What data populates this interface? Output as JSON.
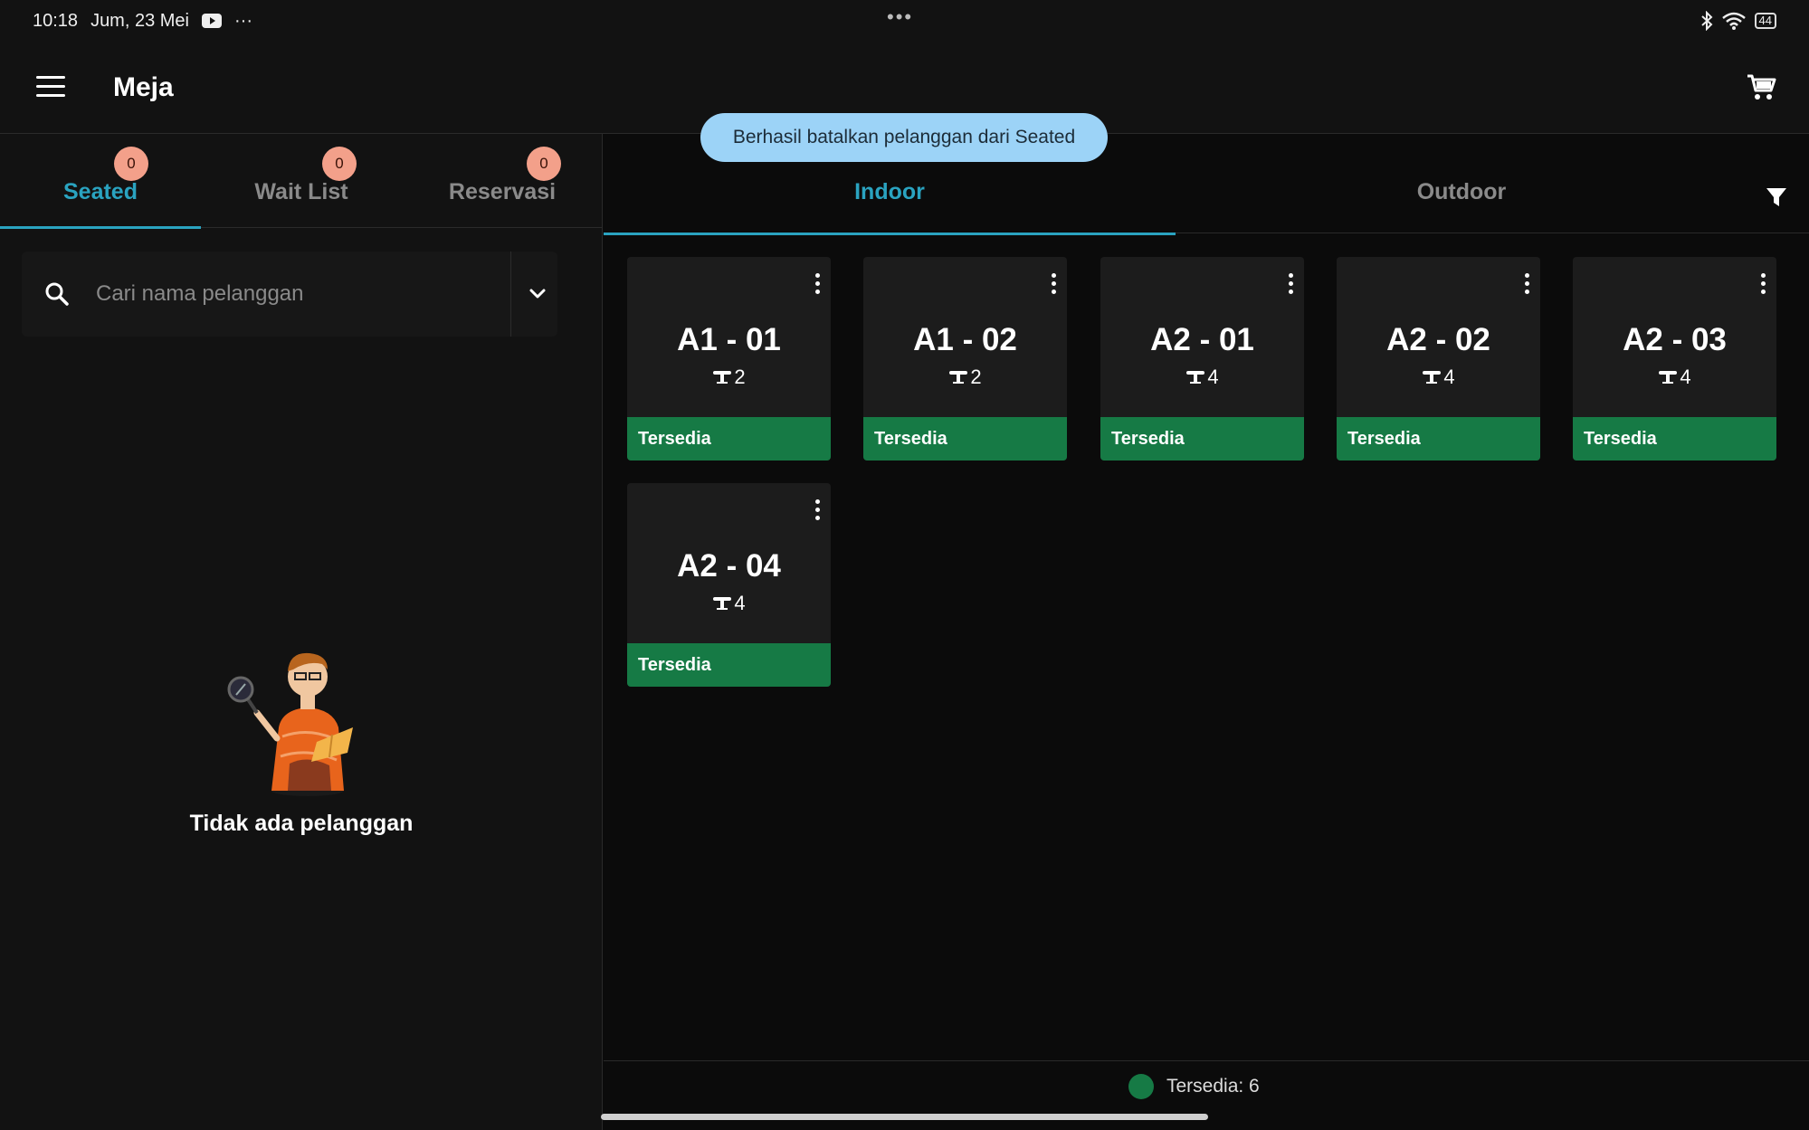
{
  "status_bar": {
    "time": "10:18",
    "date": "Jum, 23 Mei",
    "more_dots": "···",
    "center_dots": "•••",
    "battery": "44"
  },
  "app_bar": {
    "title": "Meja"
  },
  "left_tabs": [
    {
      "label": "Seated",
      "badge": "0",
      "active": true
    },
    {
      "label": "Wait List",
      "badge": "0",
      "active": false
    },
    {
      "label": "Reservasi",
      "badge": "0",
      "active": false
    }
  ],
  "search": {
    "placeholder": "Cari nama pelanggan",
    "value": ""
  },
  "empty_state": {
    "text": "Tidak ada pelanggan"
  },
  "right_tabs": [
    {
      "label": "Indoor",
      "active": true
    },
    {
      "label": "Outdoor",
      "active": false
    }
  ],
  "toast": {
    "text": "Berhasil batalkan pelanggan dari Seated"
  },
  "tables": [
    {
      "name": "A1 - 01",
      "capacity": "2",
      "status": "Tersedia"
    },
    {
      "name": "A1 - 02",
      "capacity": "2",
      "status": "Tersedia"
    },
    {
      "name": "A2 - 01",
      "capacity": "4",
      "status": "Tersedia"
    },
    {
      "name": "A2 - 02",
      "capacity": "4",
      "status": "Tersedia"
    },
    {
      "name": "A2 - 03",
      "capacity": "4",
      "status": "Tersedia"
    },
    {
      "name": "A2 - 04",
      "capacity": "4",
      "status": "Tersedia"
    }
  ],
  "legend": {
    "text": "Tersedia: 6",
    "color": "#167a45"
  },
  "colors": {
    "accent": "#2aa3c0",
    "available": "#167a45",
    "badge": "#f3a08a",
    "toast": "#9cd3f7"
  }
}
